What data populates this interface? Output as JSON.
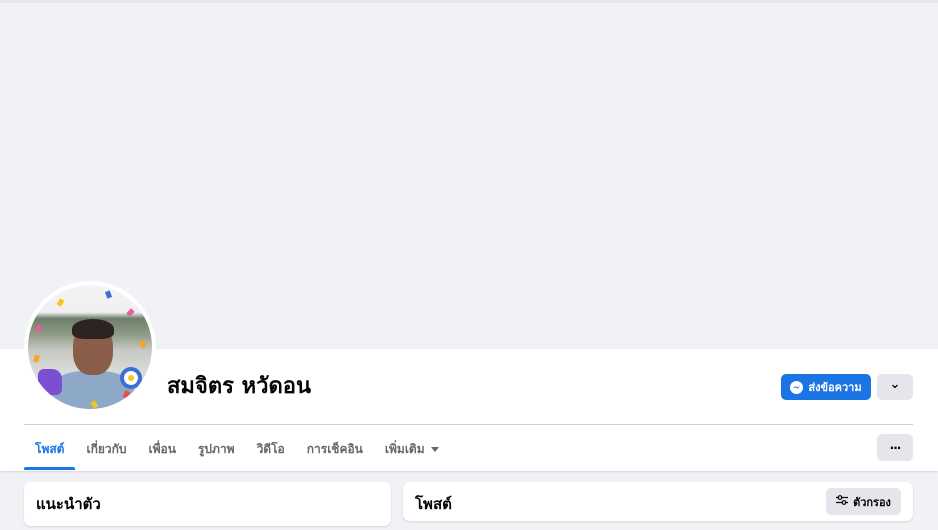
{
  "profile": {
    "name": "สมจิตร หวัดอน"
  },
  "actions": {
    "message_label": "ส่งข้อความ",
    "dropdown_glyph": "⌄",
    "more_glyph": "···"
  },
  "tabs": [
    {
      "label": "โพสต์",
      "active": true
    },
    {
      "label": "เกี่ยวกับ",
      "active": false
    },
    {
      "label": "เพื่อน",
      "active": false
    },
    {
      "label": "รูปภาพ",
      "active": false
    },
    {
      "label": "วิดีโอ",
      "active": false
    },
    {
      "label": "การเช็คอิน",
      "active": false
    },
    {
      "label": "เพิ่มเติม",
      "active": false
    }
  ],
  "intro": {
    "title": "แนะนำตัว"
  },
  "posts": {
    "title": "โพสต์",
    "filter_label": "ตัวกรอง"
  },
  "colors": {
    "accent": "#1b74e4",
    "page_bg": "#f0f2f5",
    "button_gray": "#e4e6eb"
  },
  "icons": {
    "messenger": "messenger-icon",
    "chevron": "chevron-down-icon",
    "more": "more-icon",
    "filter": "filter-icon"
  }
}
